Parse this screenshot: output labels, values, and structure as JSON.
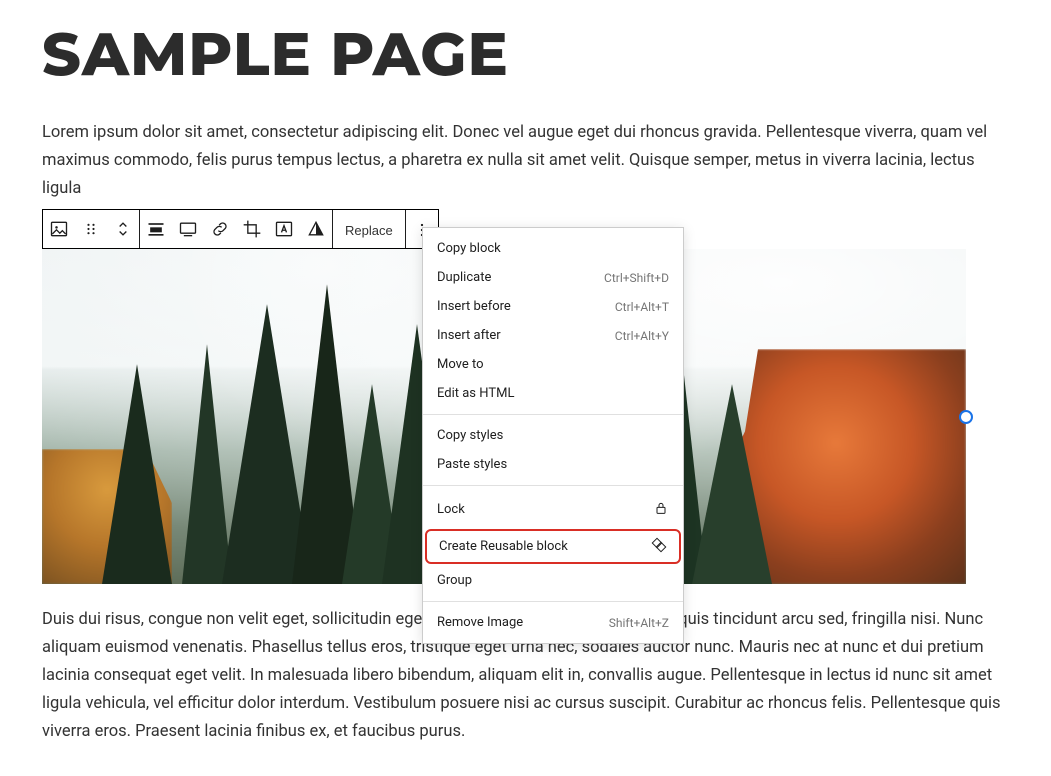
{
  "title": "SAMPLE PAGE",
  "paragraph_top": "Lorem ipsum dolor sit amet, consectetur adipiscing elit. Donec vel augue eget dui rhoncus gravida. Pellentesque viverra, quam vel maximus commodo, felis purus tempus lectus, a pharetra ex nulla sit amet velit. Quisque semper, metus in viverra lacinia, lectus ligula",
  "paragraph_bottom": "Duis dui risus, congue non velit eget, sollicitudin egestas dolor. Maecenas sagittis urna quis tincidunt arcu sed, fringilla nisi. Nunc aliquam euismod venenatis. Phasellus tellus eros, tristique eget urna nec, sodales auctor nunc. Mauris nec at nunc et dui pretium lacinia consequat eget velit. In malesuada libero bibendum, aliquam elit in, convallis augue. Pellentesque in lectus id nunc sit amet ligula vehicula, vel efficitur dolor interdum. Vestibulum posuere nisi ac cursus suscipit. Curabitur ac rhoncus felis. Pellentesque quis viverra eros. Praesent lacinia finibus ex, et faucibus purus.",
  "toolbar": {
    "replace": "Replace"
  },
  "menu": {
    "copy_block": "Copy block",
    "duplicate": "Duplicate",
    "duplicate_sc": "Ctrl+Shift+D",
    "insert_before": "Insert before",
    "insert_before_sc": "Ctrl+Alt+T",
    "insert_after": "Insert after",
    "insert_after_sc": "Ctrl+Alt+Y",
    "move_to": "Move to",
    "edit_html": "Edit as HTML",
    "copy_styles": "Copy styles",
    "paste_styles": "Paste styles",
    "lock": "Lock",
    "create_reusable": "Create Reusable block",
    "group": "Group",
    "remove": "Remove Image",
    "remove_sc": "Shift+Alt+Z"
  }
}
